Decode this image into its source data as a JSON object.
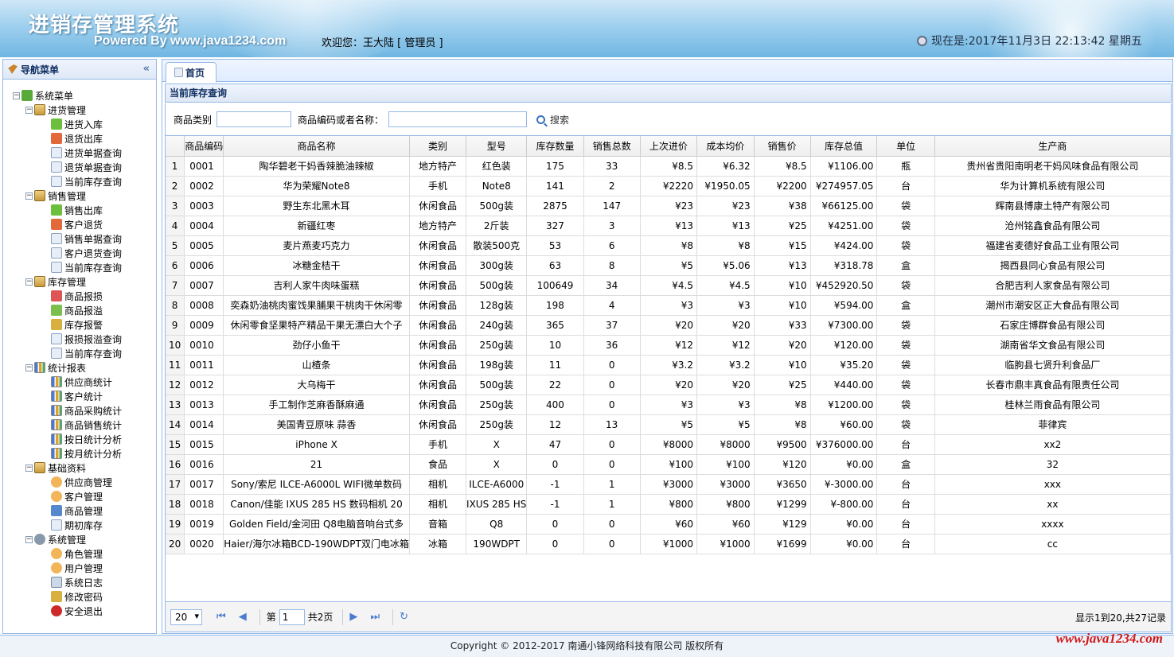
{
  "header": {
    "app_title": "进销存管理系统",
    "powered_by": "Powered By www.java1234.com",
    "welcome": "欢迎您：王大陆 [ 管理员 ]",
    "clock": "现在是:2017年11月3日 22:13:42 星期五"
  },
  "nav": {
    "title": "导航菜单",
    "collapse_glyph": "«",
    "root": "系统菜单",
    "groups": [
      {
        "label": "进货管理",
        "items": [
          "进货入库",
          "退货出库",
          "进货单据查询",
          "退货单据查询",
          "当前库存查询"
        ]
      },
      {
        "label": "销售管理",
        "items": [
          "销售出库",
          "客户退货",
          "销售单据查询",
          "客户退货查询",
          "当前库存查询"
        ]
      },
      {
        "label": "库存管理",
        "items": [
          "商品报损",
          "商品报溢",
          "库存报警",
          "报损报溢查询",
          "当前库存查询"
        ]
      },
      {
        "label": "统计报表",
        "items": [
          "供应商统计",
          "客户统计",
          "商品采购统计",
          "商品销售统计",
          "按日统计分析",
          "按月统计分析"
        ]
      },
      {
        "label": "基础资料",
        "items": [
          "供应商管理",
          "客户管理",
          "商品管理",
          "期初库存"
        ]
      },
      {
        "label": "系统管理",
        "items": [
          "角色管理",
          "用户管理",
          "系统日志",
          "修改密码",
          "安全退出"
        ]
      }
    ]
  },
  "tabs": [
    {
      "label": "首页"
    }
  ],
  "panel": {
    "title": "当前库存查询"
  },
  "search": {
    "category_label": "商品类别",
    "name_label": "商品编码或者名称：",
    "category_value": "",
    "name_value": "",
    "button_label": "搜索"
  },
  "table": {
    "columns": [
      "商品编码",
      "商品名称",
      "类别",
      "型号",
      "库存数量",
      "销售总数",
      "上次进价",
      "成本均价",
      "销售价",
      "库存总值",
      "单位",
      "生产商"
    ],
    "rows": [
      [
        "1",
        "0001",
        "陶华碧老干妈香辣脆油辣椒",
        "地方特产",
        "红色装",
        "175",
        "33",
        "¥8.5",
        "¥6.32",
        "¥8.5",
        "¥1106.00",
        "瓶",
        "贵州省贵阳南明老干妈风味食品有限公司"
      ],
      [
        "2",
        "0002",
        "华为荣耀Note8",
        "手机",
        "Note8",
        "141",
        "2",
        "¥2220",
        "¥1950.05",
        "¥2200",
        "¥274957.05",
        "台",
        "华为计算机系统有限公司"
      ],
      [
        "3",
        "0003",
        "野生东北黑木耳",
        "休闲食品",
        "500g装",
        "2875",
        "147",
        "¥23",
        "¥23",
        "¥38",
        "¥66125.00",
        "袋",
        "辉南县博康土特产有限公司"
      ],
      [
        "4",
        "0004",
        "新疆红枣",
        "地方特产",
        "2斤装",
        "327",
        "3",
        "¥13",
        "¥13",
        "¥25",
        "¥4251.00",
        "袋",
        "沧州铭鑫食品有限公司"
      ],
      [
        "5",
        "0005",
        "麦片燕麦巧克力",
        "休闲食品",
        "散装500克",
        "53",
        "6",
        "¥8",
        "¥8",
        "¥15",
        "¥424.00",
        "袋",
        "福建省麦德好食品工业有限公司"
      ],
      [
        "6",
        "0006",
        "冰糖金桔干",
        "休闲食品",
        "300g装",
        "63",
        "8",
        "¥5",
        "¥5.06",
        "¥13",
        "¥318.78",
        "盒",
        "揭西县同心食品有限公司"
      ],
      [
        "7",
        "0007",
        "吉利人家牛肉味蛋糕",
        "休闲食品",
        "500g装",
        "100649",
        "34",
        "¥4.5",
        "¥4.5",
        "¥10",
        "¥452920.50",
        "袋",
        "合肥吉利人家食品有限公司"
      ],
      [
        "8",
        "0008",
        "奕森奶油桃肉蜜饯果脯果干桃肉干休闲零",
        "休闲食品",
        "128g装",
        "198",
        "4",
        "¥3",
        "¥3",
        "¥10",
        "¥594.00",
        "盒",
        "潮州市潮安区正大食品有限公司"
      ],
      [
        "9",
        "0009",
        "休闲零食坚果特产精品干果无漂白大个子",
        "休闲食品",
        "240g装",
        "365",
        "37",
        "¥20",
        "¥20",
        "¥33",
        "¥7300.00",
        "袋",
        "石家庄博群食品有限公司"
      ],
      [
        "10",
        "0010",
        "劲仔小鱼干",
        "休闲食品",
        "250g装",
        "10",
        "36",
        "¥12",
        "¥12",
        "¥20",
        "¥120.00",
        "袋",
        "湖南省华文食品有限公司"
      ],
      [
        "11",
        "0011",
        "山楂条",
        "休闲食品",
        "198g装",
        "11",
        "0",
        "¥3.2",
        "¥3.2",
        "¥10",
        "¥35.20",
        "袋",
        "临朐县七贤升利食品厂"
      ],
      [
        "12",
        "0012",
        "大乌梅干",
        "休闲食品",
        "500g装",
        "22",
        "0",
        "¥20",
        "¥20",
        "¥25",
        "¥440.00",
        "袋",
        "长春市鼎丰真食品有限责任公司"
      ],
      [
        "13",
        "0013",
        "手工制作芝麻香酥麻通",
        "休闲食品",
        "250g装",
        "400",
        "0",
        "¥3",
        "¥3",
        "¥8",
        "¥1200.00",
        "袋",
        "桂林兰雨食品有限公司"
      ],
      [
        "14",
        "0014",
        "美国青豆原味 蒜香",
        "休闲食品",
        "250g装",
        "12",
        "13",
        "¥5",
        "¥5",
        "¥8",
        "¥60.00",
        "袋",
        "菲律宾"
      ],
      [
        "15",
        "0015",
        "iPhone X",
        "手机",
        "X",
        "47",
        "0",
        "¥8000",
        "¥8000",
        "¥9500",
        "¥376000.00",
        "台",
        "xx2"
      ],
      [
        "16",
        "0016",
        "21",
        "食品",
        "X",
        "0",
        "0",
        "¥100",
        "¥100",
        "¥120",
        "¥0.00",
        "盒",
        "32"
      ],
      [
        "17",
        "0017",
        "Sony/索尼 ILCE-A6000L WIFI微单数码",
        "相机",
        "ILCE-A6000",
        "-1",
        "1",
        "¥3000",
        "¥3000",
        "¥3650",
        "¥-3000.00",
        "台",
        "xxx"
      ],
      [
        "18",
        "0018",
        "Canon/佳能 IXUS 285 HS 数码相机 20",
        "相机",
        "IXUS 285 HS",
        "-1",
        "1",
        "¥800",
        "¥800",
        "¥1299",
        "¥-800.00",
        "台",
        "xx"
      ],
      [
        "19",
        "0019",
        "Golden Field/金河田 Q8电脑音响台式多",
        "音箱",
        "Q8",
        "0",
        "0",
        "¥60",
        "¥60",
        "¥129",
        "¥0.00",
        "台",
        "xxxx"
      ],
      [
        "20",
        "0020",
        "Haier/海尔冰箱BCD-190WDPT双门电冰箱",
        "冰箱",
        "190WDPT",
        "0",
        "0",
        "¥1000",
        "¥1000",
        "¥1699",
        "¥0.00",
        "台",
        "cc"
      ]
    ]
  },
  "pager": {
    "page_size": "20",
    "page_prefix": "第",
    "page_value": "1",
    "page_suffix": "共2页",
    "info": "显示1到20,共27记录",
    "first_glyph": "⏮",
    "prev_glyph": "◀",
    "next_glyph": "▶",
    "last_glyph": "⏭",
    "refresh_glyph": "↻"
  },
  "footer": {
    "copyright": "Copyright © 2012-2017 南通小锋网络科技有限公司 版权所有",
    "brand": "www.java1234.com"
  },
  "colors": {
    "border": "#95b8e7",
    "header_bg": "#9fd0ee",
    "brand_red": "#d01818"
  }
}
